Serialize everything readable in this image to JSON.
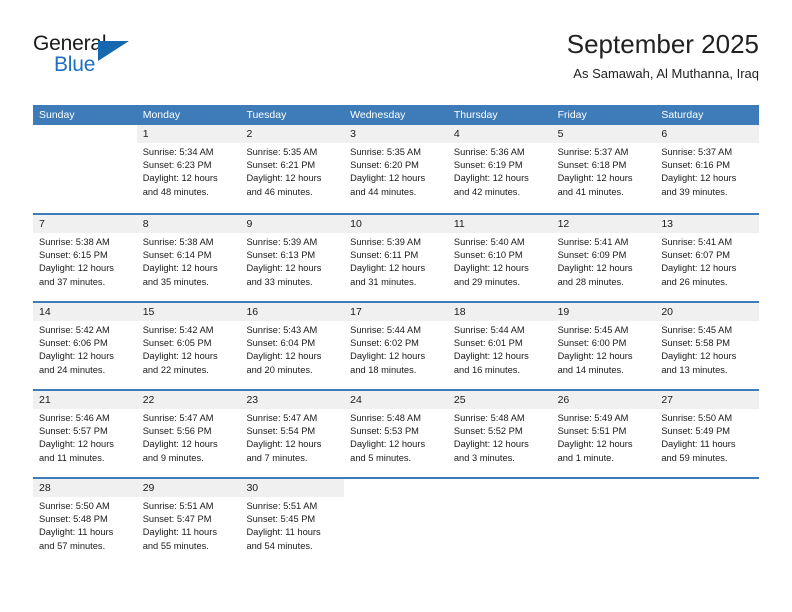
{
  "brand": {
    "name_part1": "General",
    "name_part2": "Blue",
    "triangle_color": "#1568b0",
    "blue_text_color": "#1f6fc0"
  },
  "header": {
    "title": "September 2025",
    "subtitle": "As Samawah, Al Muthanna, Iraq"
  },
  "theme": {
    "header_blue": "#3d7cb8",
    "daynum_band_gray": "#f0f0f0",
    "text_color": "#1a1a1a"
  },
  "weekdays": [
    "Sunday",
    "Monday",
    "Tuesday",
    "Wednesday",
    "Thursday",
    "Friday",
    "Saturday"
  ],
  "weeks": [
    [
      {
        "day": "",
        "sunrise": "",
        "sunset": "",
        "daylight1": "",
        "daylight2": ""
      },
      {
        "day": "1",
        "sunrise": "Sunrise: 5:34 AM",
        "sunset": "Sunset: 6:23 PM",
        "daylight1": "Daylight: 12 hours",
        "daylight2": "and 48 minutes."
      },
      {
        "day": "2",
        "sunrise": "Sunrise: 5:35 AM",
        "sunset": "Sunset: 6:21 PM",
        "daylight1": "Daylight: 12 hours",
        "daylight2": "and 46 minutes."
      },
      {
        "day": "3",
        "sunrise": "Sunrise: 5:35 AM",
        "sunset": "Sunset: 6:20 PM",
        "daylight1": "Daylight: 12 hours",
        "daylight2": "and 44 minutes."
      },
      {
        "day": "4",
        "sunrise": "Sunrise: 5:36 AM",
        "sunset": "Sunset: 6:19 PM",
        "daylight1": "Daylight: 12 hours",
        "daylight2": "and 42 minutes."
      },
      {
        "day": "5",
        "sunrise": "Sunrise: 5:37 AM",
        "sunset": "Sunset: 6:18 PM",
        "daylight1": "Daylight: 12 hours",
        "daylight2": "and 41 minutes."
      },
      {
        "day": "6",
        "sunrise": "Sunrise: 5:37 AM",
        "sunset": "Sunset: 6:16 PM",
        "daylight1": "Daylight: 12 hours",
        "daylight2": "and 39 minutes."
      }
    ],
    [
      {
        "day": "7",
        "sunrise": "Sunrise: 5:38 AM",
        "sunset": "Sunset: 6:15 PM",
        "daylight1": "Daylight: 12 hours",
        "daylight2": "and 37 minutes."
      },
      {
        "day": "8",
        "sunrise": "Sunrise: 5:38 AM",
        "sunset": "Sunset: 6:14 PM",
        "daylight1": "Daylight: 12 hours",
        "daylight2": "and 35 minutes."
      },
      {
        "day": "9",
        "sunrise": "Sunrise: 5:39 AM",
        "sunset": "Sunset: 6:13 PM",
        "daylight1": "Daylight: 12 hours",
        "daylight2": "and 33 minutes."
      },
      {
        "day": "10",
        "sunrise": "Sunrise: 5:39 AM",
        "sunset": "Sunset: 6:11 PM",
        "daylight1": "Daylight: 12 hours",
        "daylight2": "and 31 minutes."
      },
      {
        "day": "11",
        "sunrise": "Sunrise: 5:40 AM",
        "sunset": "Sunset: 6:10 PM",
        "daylight1": "Daylight: 12 hours",
        "daylight2": "and 29 minutes."
      },
      {
        "day": "12",
        "sunrise": "Sunrise: 5:41 AM",
        "sunset": "Sunset: 6:09 PM",
        "daylight1": "Daylight: 12 hours",
        "daylight2": "and 28 minutes."
      },
      {
        "day": "13",
        "sunrise": "Sunrise: 5:41 AM",
        "sunset": "Sunset: 6:07 PM",
        "daylight1": "Daylight: 12 hours",
        "daylight2": "and 26 minutes."
      }
    ],
    [
      {
        "day": "14",
        "sunrise": "Sunrise: 5:42 AM",
        "sunset": "Sunset: 6:06 PM",
        "daylight1": "Daylight: 12 hours",
        "daylight2": "and 24 minutes."
      },
      {
        "day": "15",
        "sunrise": "Sunrise: 5:42 AM",
        "sunset": "Sunset: 6:05 PM",
        "daylight1": "Daylight: 12 hours",
        "daylight2": "and 22 minutes."
      },
      {
        "day": "16",
        "sunrise": "Sunrise: 5:43 AM",
        "sunset": "Sunset: 6:04 PM",
        "daylight1": "Daylight: 12 hours",
        "daylight2": "and 20 minutes."
      },
      {
        "day": "17",
        "sunrise": "Sunrise: 5:44 AM",
        "sunset": "Sunset: 6:02 PM",
        "daylight1": "Daylight: 12 hours",
        "daylight2": "and 18 minutes."
      },
      {
        "day": "18",
        "sunrise": "Sunrise: 5:44 AM",
        "sunset": "Sunset: 6:01 PM",
        "daylight1": "Daylight: 12 hours",
        "daylight2": "and 16 minutes."
      },
      {
        "day": "19",
        "sunrise": "Sunrise: 5:45 AM",
        "sunset": "Sunset: 6:00 PM",
        "daylight1": "Daylight: 12 hours",
        "daylight2": "and 14 minutes."
      },
      {
        "day": "20",
        "sunrise": "Sunrise: 5:45 AM",
        "sunset": "Sunset: 5:58 PM",
        "daylight1": "Daylight: 12 hours",
        "daylight2": "and 13 minutes."
      }
    ],
    [
      {
        "day": "21",
        "sunrise": "Sunrise: 5:46 AM",
        "sunset": "Sunset: 5:57 PM",
        "daylight1": "Daylight: 12 hours",
        "daylight2": "and 11 minutes."
      },
      {
        "day": "22",
        "sunrise": "Sunrise: 5:47 AM",
        "sunset": "Sunset: 5:56 PM",
        "daylight1": "Daylight: 12 hours",
        "daylight2": "and 9 minutes."
      },
      {
        "day": "23",
        "sunrise": "Sunrise: 5:47 AM",
        "sunset": "Sunset: 5:54 PM",
        "daylight1": "Daylight: 12 hours",
        "daylight2": "and 7 minutes."
      },
      {
        "day": "24",
        "sunrise": "Sunrise: 5:48 AM",
        "sunset": "Sunset: 5:53 PM",
        "daylight1": "Daylight: 12 hours",
        "daylight2": "and 5 minutes."
      },
      {
        "day": "25",
        "sunrise": "Sunrise: 5:48 AM",
        "sunset": "Sunset: 5:52 PM",
        "daylight1": "Daylight: 12 hours",
        "daylight2": "and 3 minutes."
      },
      {
        "day": "26",
        "sunrise": "Sunrise: 5:49 AM",
        "sunset": "Sunset: 5:51 PM",
        "daylight1": "Daylight: 12 hours",
        "daylight2": "and 1 minute."
      },
      {
        "day": "27",
        "sunrise": "Sunrise: 5:50 AM",
        "sunset": "Sunset: 5:49 PM",
        "daylight1": "Daylight: 11 hours",
        "daylight2": "and 59 minutes."
      }
    ],
    [
      {
        "day": "28",
        "sunrise": "Sunrise: 5:50 AM",
        "sunset": "Sunset: 5:48 PM",
        "daylight1": "Daylight: 11 hours",
        "daylight2": "and 57 minutes."
      },
      {
        "day": "29",
        "sunrise": "Sunrise: 5:51 AM",
        "sunset": "Sunset: 5:47 PM",
        "daylight1": "Daylight: 11 hours",
        "daylight2": "and 55 minutes."
      },
      {
        "day": "30",
        "sunrise": "Sunrise: 5:51 AM",
        "sunset": "Sunset: 5:45 PM",
        "daylight1": "Daylight: 11 hours",
        "daylight2": "and 54 minutes."
      },
      {
        "day": "",
        "sunrise": "",
        "sunset": "",
        "daylight1": "",
        "daylight2": ""
      },
      {
        "day": "",
        "sunrise": "",
        "sunset": "",
        "daylight1": "",
        "daylight2": ""
      },
      {
        "day": "",
        "sunrise": "",
        "sunset": "",
        "daylight1": "",
        "daylight2": ""
      },
      {
        "day": "",
        "sunrise": "",
        "sunset": "",
        "daylight1": "",
        "daylight2": ""
      }
    ]
  ]
}
